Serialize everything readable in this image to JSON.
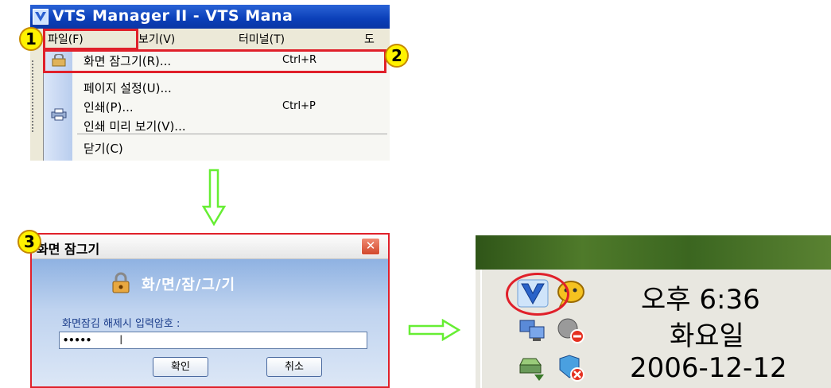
{
  "app_window": {
    "title": "VTS Manager II - VTS Mana",
    "menubar": [
      "파일(F)",
      "보기(V)",
      "터미널(T)",
      "도"
    ],
    "file_menu": {
      "items": [
        {
          "label": "화면 잠그기(R)...",
          "shortcut": "Ctrl+R"
        },
        {
          "label": "페이지 설정(U)...",
          "shortcut": ""
        },
        {
          "label": "인쇄(P)...",
          "shortcut": "Ctrl+P"
        },
        {
          "label": "인쇄 미리 보기(V)...",
          "shortcut": ""
        },
        {
          "label": "닫기(C)",
          "shortcut": ""
        }
      ]
    }
  },
  "steps": [
    "1",
    "2",
    "3"
  ],
  "lock_dialog": {
    "title": "화면 잠그기",
    "close_glyph": "✕",
    "heading": "화/면/잠/그/기",
    "password_label": "화면잠김 해제시 입력암호 :",
    "password_value": "•••••",
    "ok_label": "확인",
    "cancel_label": "취소"
  },
  "tray": {
    "time": "오후 6:36",
    "day": "화요일",
    "date": "2006-12-12"
  },
  "colors": {
    "highlight": "#e0202a",
    "badge": "#fff200",
    "arrow": "#66ee33",
    "titlebar": "#0b3fb8"
  },
  "icons": [
    "vts-app-icon",
    "print-icon",
    "lock-icon",
    "v-tray-icon",
    "messenger-icon",
    "network-icon",
    "no-connection-icon",
    "safely-remove-icon",
    "security-alert-icon"
  ]
}
